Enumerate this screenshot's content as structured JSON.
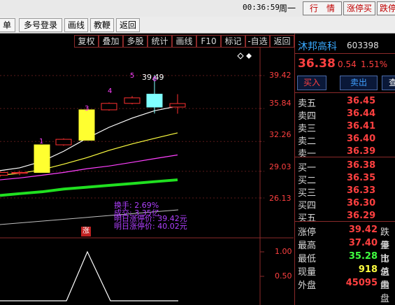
{
  "topbar": {
    "time": "00:36:59",
    "weekday": "周一",
    "btn_market": "行　情",
    "btn_limit_up": "涨停买",
    "btn_limit_down": "跌停"
  },
  "menubar": {
    "item_single": "单",
    "item_multi_login": "多号登录",
    "item_draw": "画线",
    "item_coach": "教鞭",
    "item_back": "返回"
  },
  "chart_toolbar": {
    "items": [
      "复权",
      "叠加",
      "多股",
      "统计",
      "画线",
      "F10",
      "标记",
      "-自选",
      "返回"
    ]
  },
  "chart": {
    "y_ticks": [
      "39.42",
      "35.84",
      "32.26",
      "29.03",
      "26.13"
    ],
    "peak_label": "39.49",
    "candle_marks": [
      "1",
      "3",
      "4",
      "5",
      "6"
    ],
    "annotations": {
      "turnover": "换手: 2.69%",
      "volume": "成交: 3.35亿",
      "limit_up_today": "明日涨停价: 39.42元",
      "limit_up_next": "明日涨停价: 40.02元"
    },
    "zhang_badge": "涨",
    "indicator_ticks": [
      "1.00",
      "0.50"
    ]
  },
  "quote": {
    "name": "沐邦高科",
    "code": "603398",
    "price": "36.38",
    "change": "0.54",
    "change_pct": "1.51%",
    "btn_buy": "买入",
    "btn_sell": "卖出",
    "btn_query": "查",
    "asks": [
      {
        "label": "卖五",
        "price": "36.45"
      },
      {
        "label": "卖四",
        "price": "36.44"
      },
      {
        "label": "卖三",
        "price": "36.41"
      },
      {
        "label": "卖二",
        "price": "36.40"
      },
      {
        "label": "卖一",
        "price": "36.39"
      }
    ],
    "bids": [
      {
        "label": "买一",
        "price": "36.38"
      },
      {
        "label": "买二",
        "price": "36.35"
      },
      {
        "label": "买三",
        "price": "36.33"
      },
      {
        "label": "买四",
        "price": "36.30"
      },
      {
        "label": "买五",
        "price": "36.29"
      }
    ],
    "info": [
      {
        "label": "涨停",
        "value": "39.42",
        "color": "#ff4040",
        "label2": "跌停"
      },
      {
        "label": "最高",
        "value": "37.40",
        "color": "#ff4040",
        "label2": "量比"
      },
      {
        "label": "最低",
        "value": "35.28",
        "color": "#40ff40",
        "label2": "市值"
      },
      {
        "label": "现量",
        "value": "918",
        "color": "#ffff40",
        "label2": "总量"
      },
      {
        "label": "外盘",
        "value": "45095",
        "color": "#ff4040",
        "label2": "内盘"
      }
    ]
  },
  "chart_data": {
    "type": "candlestick",
    "y_ticks": [
      39.42,
      35.84,
      32.26,
      29.03,
      26.13
    ],
    "candles": [
      {
        "open": 28.6,
        "close": 28.9,
        "high": 29.0,
        "low": 28.4
      },
      {
        "open": 28.8,
        "close": 28.9,
        "high": 29.1,
        "low": 28.6
      },
      {
        "open": 28.9,
        "close": 31.9,
        "high": 31.9,
        "low": 28.9
      },
      {
        "open": 31.9,
        "close": 32.5,
        "high": 32.6,
        "low": 31.8
      },
      {
        "open": 32.4,
        "close": 35.7,
        "high": 35.8,
        "low": 32.4
      },
      {
        "open": 35.7,
        "close": 36.4,
        "high": 36.5,
        "low": 35.6
      },
      {
        "open": 36.4,
        "close": 37.0,
        "high": 37.2,
        "low": 36.3
      },
      {
        "open": 37.4,
        "close": 36.0,
        "high": 39.49,
        "low": 35.3
      },
      {
        "open": 36.0,
        "close": 36.38,
        "high": 37.4,
        "low": 35.28
      }
    ],
    "ma_lines": [
      {
        "color": "#ffffff",
        "values": [
          29.1,
          29.4,
          30.1,
          31.2,
          32.6,
          33.8,
          34.8,
          35.6,
          36.1
        ]
      },
      {
        "color": "#ffff40",
        "values": [
          28.6,
          28.8,
          29.2,
          29.8,
          30.5,
          31.3,
          32.0,
          32.6,
          33.2
        ]
      },
      {
        "color": "#ff40ff",
        "values": [
          28.1,
          28.3,
          28.6,
          28.9,
          29.3,
          29.6,
          30.0,
          30.4,
          30.8
        ]
      },
      {
        "color": "#20e020",
        "values": [
          26.4,
          26.6,
          26.8,
          27.1,
          27.3,
          27.5,
          27.7,
          27.9,
          28.1
        ]
      }
    ]
  }
}
